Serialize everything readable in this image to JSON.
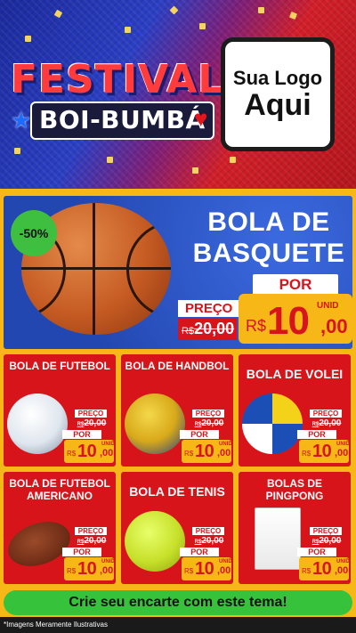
{
  "header": {
    "title_word1": "FESTIVAL",
    "title_word2": "BOI-BUMBÁ",
    "logo_line1": "Sua Logo",
    "logo_line2": "Aqui"
  },
  "featured": {
    "discount": "-50%",
    "title_line1": "BOLA DE",
    "title_line2": "BASQUETE",
    "price_label": "PREÇO",
    "old_currency": "R$",
    "old_price": "20,00",
    "por_label": "POR",
    "unit_label": "UNID",
    "new_currency": "R$",
    "new_price_int": "10",
    "new_price_dec": ",00"
  },
  "products": [
    {
      "title": "BOLA DE FUTEBOL",
      "price_label": "PREÇO",
      "old_currency": "R$",
      "old_price": "20,00",
      "por_label": "POR",
      "unit_label": "UNID",
      "currency": "R$",
      "price_int": "10",
      "price_dec": ",00"
    },
    {
      "title": "BOLA DE HANDBOL",
      "price_label": "PREÇO",
      "old_currency": "R$",
      "old_price": "20,00",
      "por_label": "POR",
      "unit_label": "UNID",
      "currency": "R$",
      "price_int": "10",
      "price_dec": ",00"
    },
    {
      "title": "BOLA DE VOLEI",
      "price_label": "PREÇO",
      "old_currency": "R$",
      "old_price": "20,00",
      "por_label": "POR",
      "unit_label": "UNID",
      "currency": "R$",
      "price_int": "10",
      "price_dec": ",00"
    },
    {
      "title": "BOLA DE FUTEBOL AMERICANO",
      "price_label": "PREÇO",
      "old_currency": "R$",
      "old_price": "20,00",
      "por_label": "POR",
      "unit_label": "UNID",
      "currency": "R$",
      "price_int": "10",
      "price_dec": ",00"
    },
    {
      "title": "BOLA DE TENIS",
      "price_label": "PREÇO",
      "old_currency": "R$",
      "old_price": "20,00",
      "por_label": "POR",
      "unit_label": "UNID",
      "currency": "R$",
      "price_int": "10",
      "price_dec": ",00"
    },
    {
      "title": "BOLAS DE PINGPONG",
      "price_label": "PREÇO",
      "old_currency": "R$",
      "old_price": "20,00",
      "por_label": "POR",
      "unit_label": "UNID",
      "currency": "R$",
      "price_int": "10",
      "price_dec": ",00"
    }
  ],
  "footer": {
    "cta": "Crie seu encarte com este tema!",
    "disclaimer": "*Imagens Meramente Ilustrativas"
  },
  "colors": {
    "accent_red": "#d8141b",
    "accent_yellow": "#f7b817",
    "accent_blue": "#2a56c9",
    "accent_green": "#37c23c"
  }
}
